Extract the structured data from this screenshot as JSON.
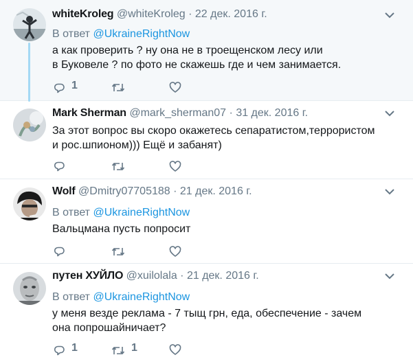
{
  "tweets": [
    {
      "name": "whiteKroleg",
      "handle": "@whiteKroleg",
      "dot": "·",
      "date": "22 дек. 2016 г.",
      "reply_prefix": "В ответ",
      "reply_handle": "@UkraineRightNow",
      "text_lines": [
        "а как проверить ? ну она не в троещенском лесу или",
        "в Буковеле ? по фото не скажешь где и чем занимается."
      ],
      "reply_count": "1",
      "retweet_count": "",
      "like_count": ""
    },
    {
      "name": "Mark Sherman",
      "handle": "@mark_sherman07",
      "dot": "·",
      "date": "31 дек. 2016 г.",
      "text_lines": [
        "За этот вопрос вы скоро окажетесь сепаратистом,террористом",
        "и рос.шпионом))) Ещё и забанят)"
      ],
      "reply_count": "",
      "retweet_count": "",
      "like_count": ""
    },
    {
      "name": "Wolf",
      "handle": "@Dmitry07705188",
      "dot": "·",
      "date": "21 дек. 2016 г.",
      "reply_prefix": "В ответ",
      "reply_handle": "@UkraineRightNow",
      "text_lines": [
        "Вальцмана пусть попросит"
      ],
      "reply_count": "",
      "retweet_count": "",
      "like_count": ""
    },
    {
      "name": "путен ХУЙЛО",
      "handle": "@xuilolala",
      "dot": "·",
      "date": "21 дек. 2016 г.",
      "reply_prefix": "В ответ",
      "reply_handle": "@UkraineRightNow",
      "text_lines": [
        "у меня везде реклама - 7 тыщ грн, еда, обеспечение - зачем",
        "она попрошайничает?"
      ],
      "reply_count": "1",
      "retweet_count": "1",
      "like_count": ""
    }
  ],
  "colors": {
    "link": "#1b95e0",
    "muted": "#657786",
    "thread_line": "#a4d9f4",
    "highlight_bg": "#f5f8fa"
  },
  "icons": [
    "reply-icon",
    "retweet-icon",
    "like-icon",
    "chevron-down-icon"
  ]
}
